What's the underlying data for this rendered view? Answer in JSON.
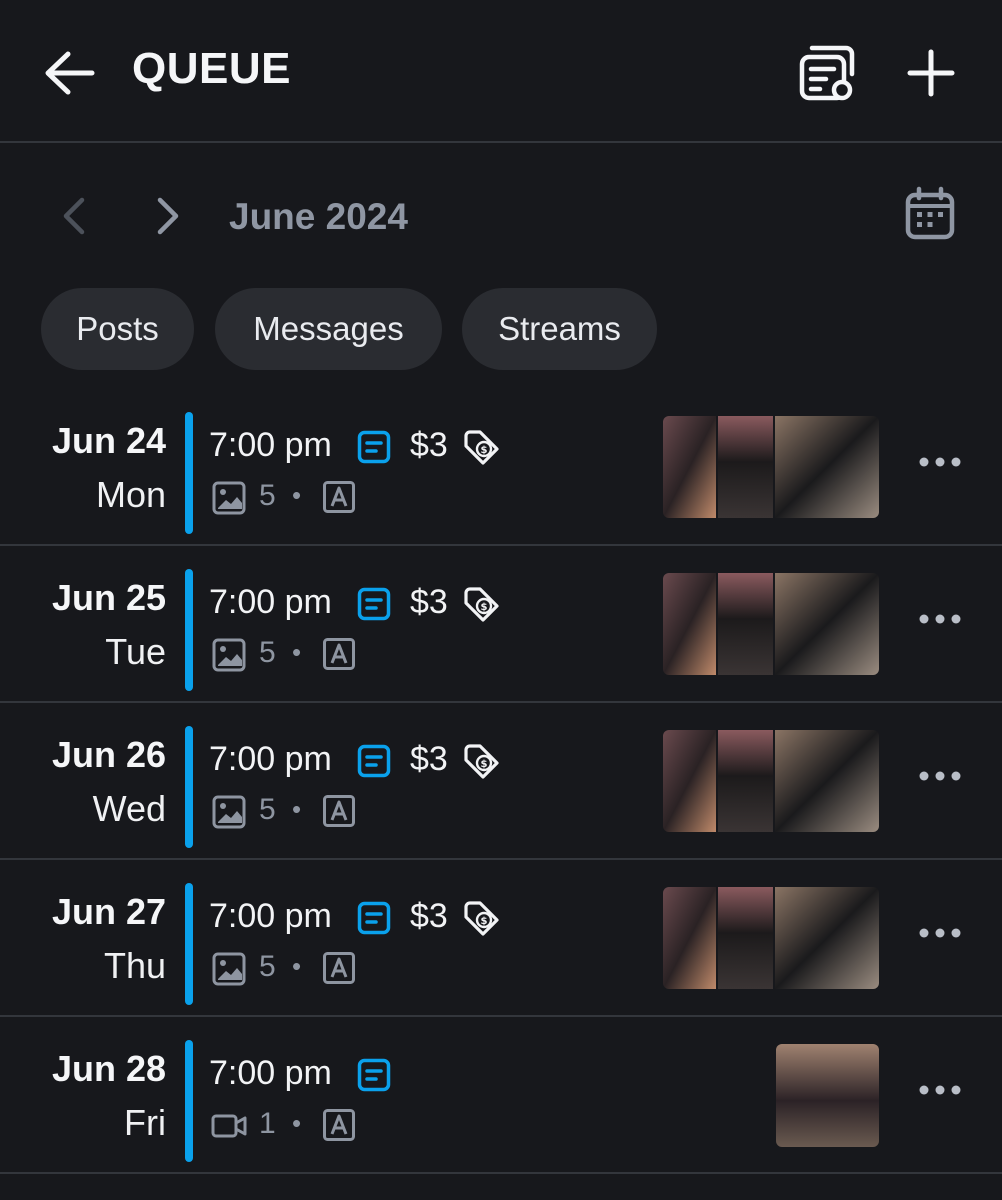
{
  "header": {
    "title": "QUEUE"
  },
  "month_nav": {
    "label": "June 2024"
  },
  "filters": [
    {
      "label": "Posts"
    },
    {
      "label": "Messages"
    },
    {
      "label": "Streams"
    }
  ],
  "accent_color": "#0aa1ec",
  "rows": [
    {
      "date": "Jun 24",
      "day": "Mon",
      "time": "7:00 pm",
      "price": "$3",
      "media_type": "image",
      "media_count": "5",
      "separator": "•"
    },
    {
      "date": "Jun 25",
      "day": "Tue",
      "time": "7:00 pm",
      "price": "$3",
      "media_type": "image",
      "media_count": "5",
      "separator": "•"
    },
    {
      "date": "Jun 26",
      "day": "Wed",
      "time": "7:00 pm",
      "price": "$3",
      "media_type": "image",
      "media_count": "5",
      "separator": "•"
    },
    {
      "date": "Jun 27",
      "day": "Thu",
      "time": "7:00 pm",
      "price": "$3",
      "media_type": "image",
      "media_count": "5",
      "separator": "•"
    },
    {
      "date": "Jun 28",
      "day": "Fri",
      "time": "7:00 pm",
      "media_type": "video",
      "media_count": "1",
      "separator": "•"
    }
  ]
}
